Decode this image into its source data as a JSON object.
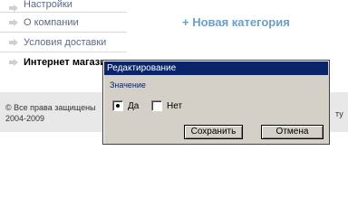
{
  "menu": {
    "items": [
      {
        "label": "Настройки"
      },
      {
        "label": "О компании"
      },
      {
        "label": "Условия доставки"
      },
      {
        "label": "Интернет магазин"
      }
    ]
  },
  "main": {
    "new_category": "+ Новая категория"
  },
  "footer": {
    "copyright_line1": "© Все права защищены",
    "copyright_line2": "2004-2009",
    "right_text": "ту"
  },
  "dialog": {
    "title": "Редактирование",
    "field_label": "Значение",
    "options": [
      {
        "label": "Да",
        "selected": true
      },
      {
        "label": "Нет",
        "selected": false
      }
    ],
    "save_label": "Сохранить",
    "cancel_label": "Отмена"
  },
  "colors": {
    "title_bar": "#0a246a",
    "dialog_bg": "#d4d0c8",
    "link_blue": "#6a9fcc",
    "menu_text": "#5a6a88",
    "footer_bg": "#e8e8e8"
  },
  "icons": {
    "menu_bullet": "arrow-right-icon"
  }
}
